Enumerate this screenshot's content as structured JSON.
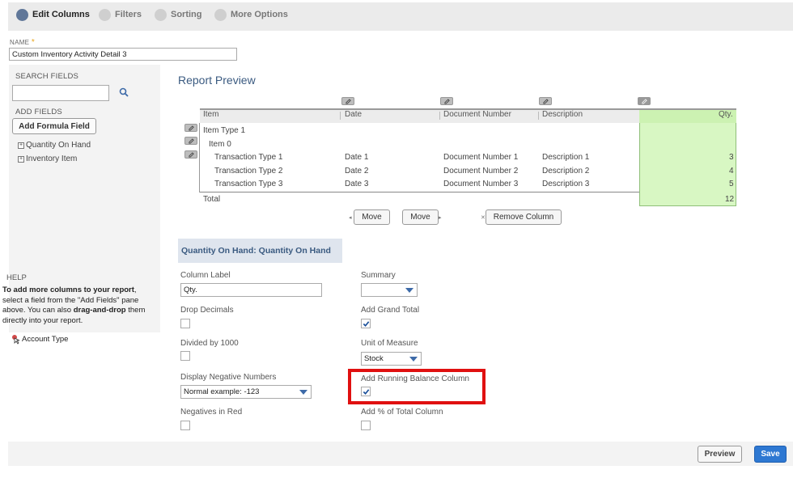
{
  "steps": [
    {
      "label": "Edit Columns",
      "active": true
    },
    {
      "label": "Filters",
      "active": false
    },
    {
      "label": "Sorting",
      "active": false
    },
    {
      "label": "More Options",
      "active": false
    }
  ],
  "name": {
    "label": "NAME",
    "required_mark": "*",
    "value": "Custom Inventory Activity Detail 3"
  },
  "sidebar": {
    "search_title": "SEARCH FIELDS",
    "search_value": "",
    "add_fields_title": "ADD FIELDS",
    "formula_button": "Add Formula Field",
    "fields": [
      "Quantity On Hand",
      "Inventory Item"
    ],
    "help_title": "HELP",
    "help_text_1": "To add more columns to your report",
    "help_text_2": ", select a field from the \"Add Fields\" pane above. You can also ",
    "help_text_3": "drag-and-drop",
    "help_text_4": " them directly into your report.",
    "drag_item": "Account Type"
  },
  "preview": {
    "title": "Report Preview",
    "columns": [
      "Item",
      "Date",
      "Document Number",
      "Description",
      "Qty."
    ],
    "rows": [
      {
        "item": "Item Type 1",
        "date": "",
        "doc": "",
        "desc": "",
        "qty": ""
      },
      {
        "item": "Item 0",
        "date": "",
        "doc": "",
        "desc": "",
        "qty": ""
      },
      {
        "item": "Transaction Type 1",
        "date": "Date 1",
        "doc": "Document Number 1",
        "desc": "Description 1",
        "qty": "3"
      },
      {
        "item": "Transaction Type 2",
        "date": "Date 2",
        "doc": "Document Number 2",
        "desc": "Description 2",
        "qty": "4"
      },
      {
        "item": "Transaction Type 3",
        "date": "Date 3",
        "doc": "Document Number 3",
        "desc": "Description 3",
        "qty": "5"
      }
    ],
    "total_label": "Total",
    "total_value": "12",
    "move_left": "Move",
    "move_right": "Move",
    "remove_column": "Remove Column"
  },
  "column_settings": {
    "section_title": "Quantity On Hand: Quantity On Hand",
    "column_label_label": "Column Label",
    "column_label_value": "Qty.",
    "summary_label": "Summary",
    "summary_value": "",
    "drop_decimals_label": "Drop Decimals",
    "add_grand_total_label": "Add Grand Total",
    "divided_label": "Divided by 1000",
    "uom_label": "Unit of Measure",
    "uom_value": "Stock",
    "neg_numbers_label": "Display Negative Numbers",
    "neg_numbers_value": "Normal  example: -123",
    "running_balance_label": "Add Running Balance Column",
    "neg_red_label": "Negatives in Red",
    "pct_total_label": "Add % of Total Column",
    "checks": {
      "drop_decimals": false,
      "grand_total": true,
      "divided": false,
      "running_balance": true,
      "neg_red": false,
      "pct_total": false
    }
  },
  "footer": {
    "preview": "Preview",
    "save": "Save"
  },
  "colors": {
    "accent": "#2e78d2",
    "highlight": "#e01010",
    "qty_fill": "#d8f7c3",
    "step_active": "#607799"
  }
}
